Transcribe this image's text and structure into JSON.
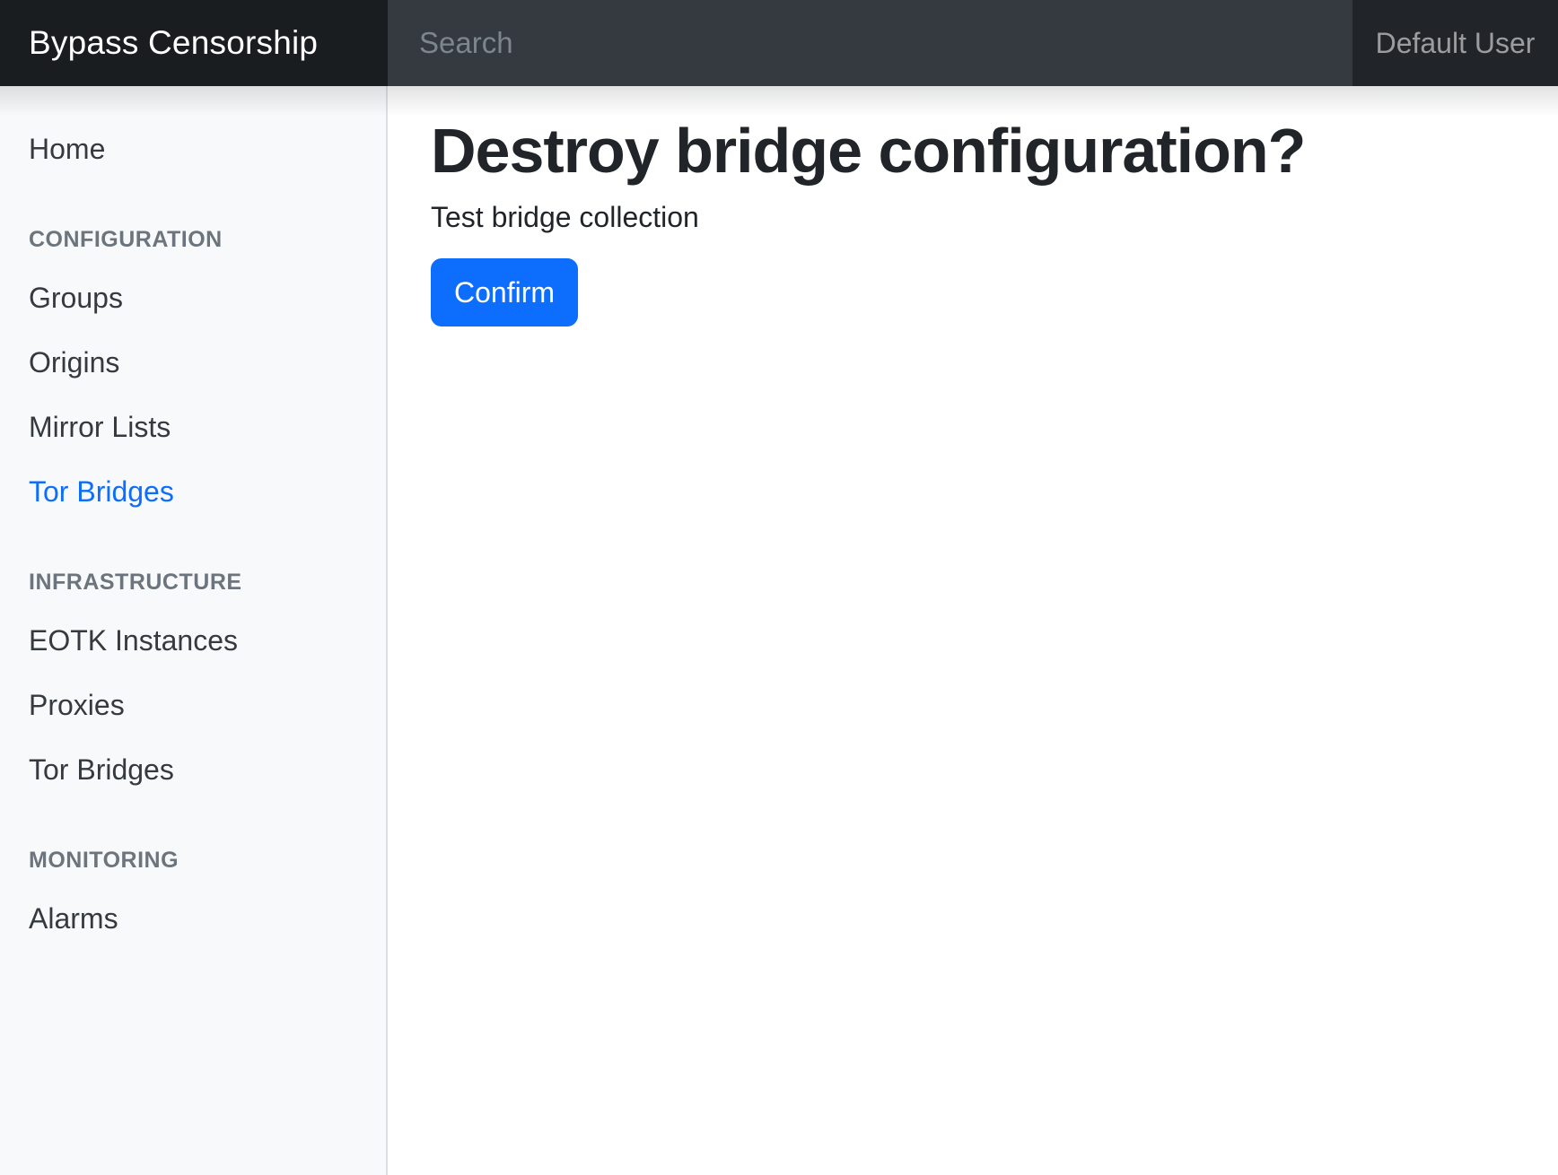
{
  "navbar": {
    "brand": "Bypass Censorship",
    "search": {
      "placeholder": "Search"
    },
    "user_label": "Default User"
  },
  "sidebar": {
    "items": [
      {
        "label": "Home",
        "type": "link",
        "active": false
      },
      {
        "label": "CONFIGURATION",
        "type": "header"
      },
      {
        "label": "Groups",
        "type": "link",
        "active": false
      },
      {
        "label": "Origins",
        "type": "link",
        "active": false
      },
      {
        "label": "Mirror Lists",
        "type": "link",
        "active": false
      },
      {
        "label": "Tor Bridges",
        "type": "link",
        "active": true
      },
      {
        "label": "INFRASTRUCTURE",
        "type": "header"
      },
      {
        "label": "EOTK Instances",
        "type": "link",
        "active": false
      },
      {
        "label": "Proxies",
        "type": "link",
        "active": false
      },
      {
        "label": "Tor Bridges",
        "type": "link",
        "active": false
      },
      {
        "label": "MONITORING",
        "type": "header"
      },
      {
        "label": "Alarms",
        "type": "link",
        "active": false
      }
    ]
  },
  "main": {
    "title": "Destroy bridge configuration?",
    "subtitle": "Test bridge collection",
    "confirm_label": "Confirm"
  },
  "colors": {
    "brand_bg": "#1a1d20",
    "search_bg": "#343a40",
    "user_bg": "#212529",
    "sidebar_bg": "#f8f9fa",
    "active_link": "#0d6efd",
    "primary_button": "#0d6efd",
    "heading_text": "#212529",
    "section_header_text": "#6c757d"
  }
}
